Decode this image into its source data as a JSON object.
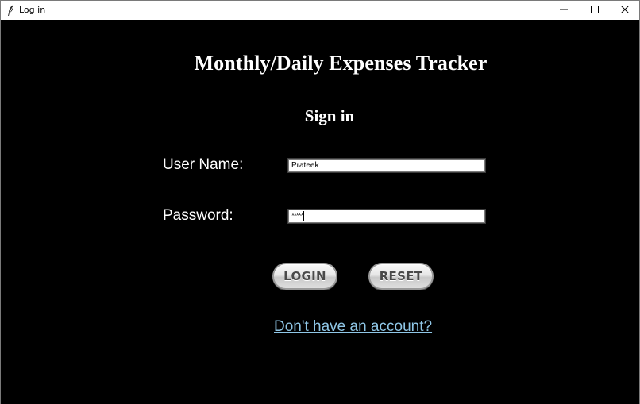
{
  "window": {
    "title": "Log in",
    "icon": "feather-icon",
    "controls": {
      "minimize": "minimize-icon",
      "maximize": "maximize-icon",
      "close": "close-icon"
    }
  },
  "form": {
    "heading": "Monthly/Daily Expenses Tracker",
    "subheading": "Sign in",
    "username_label": "User Name:",
    "username_value": "Prateek",
    "password_label": "Password:",
    "password_mask": "*****",
    "login_label": "LOGIN",
    "reset_label": "RESET",
    "signup_link": "Don't have an account?"
  },
  "colors": {
    "background": "#000000",
    "text": "#ffffff",
    "link": "#8fc6e6"
  }
}
